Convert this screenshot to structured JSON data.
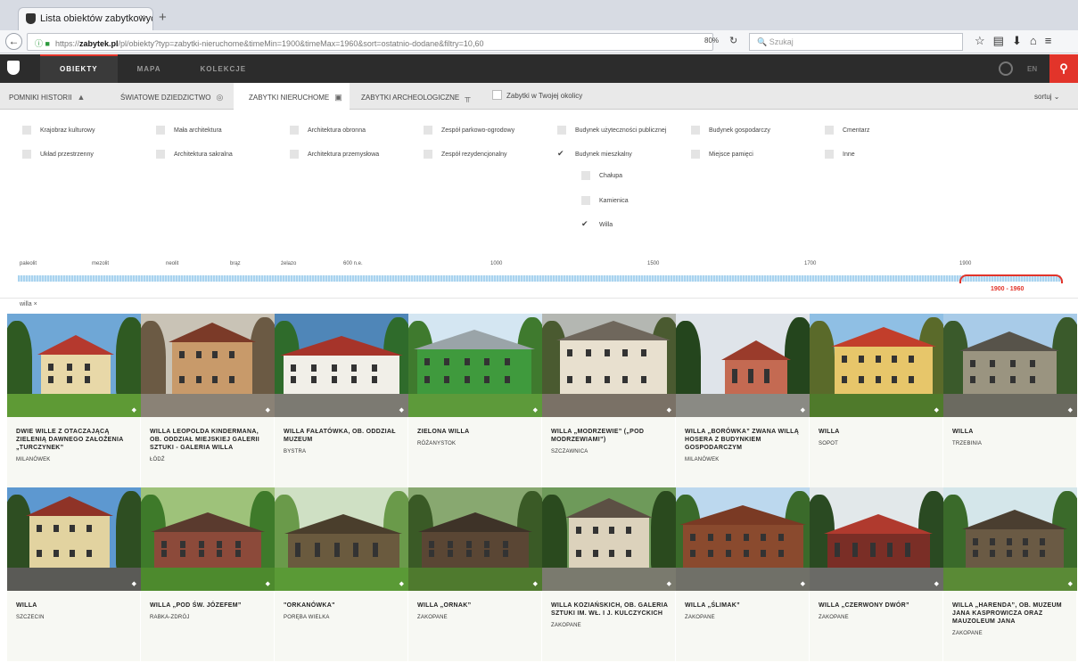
{
  "browser": {
    "tab_title": "Lista obiektów zabytkowyc...",
    "tab_close": "×",
    "new_tab": "+",
    "url_prefix": "https://",
    "url_domain": "zabytek.pl",
    "url_path": "/pl/obiekty?typ=zabytki-nieruchome&timeMin=1900&timeMax=1960&sort=ostatnio-dodane&filtry=10,60",
    "zoom": "80%",
    "search_placeholder": "Szukaj"
  },
  "site_nav": [
    {
      "label": "OBIEKTY",
      "active": true
    },
    {
      "label": "MAPA",
      "active": false
    },
    {
      "label": "KOLEKCJE",
      "active": false
    }
  ],
  "header_lang": "EN",
  "category_tabs": [
    {
      "label": "POMNIKI HISTORII",
      "icon": "monument-icon"
    },
    {
      "label": "ŚWIATOWE DZIEDZICTWO",
      "icon": "unesco-icon"
    },
    {
      "label": "ZABYTKI NIERUCHOME",
      "icon": "building-icon",
      "active": true
    },
    {
      "label": "ZABYTKI ARCHEOLOGICZNE",
      "icon": "dig-icon"
    }
  ],
  "local_filter_label": "Zabytki w Twojej okolicy",
  "sort_label": "sortuj",
  "filters": [
    {
      "label": "Krajobraz kulturowy",
      "checked": false
    },
    {
      "label": "Mała architektura",
      "checked": false
    },
    {
      "label": "Architektura obronna",
      "checked": false
    },
    {
      "label": "Zespół parkowo-ogrodowy",
      "checked": false
    },
    {
      "label": "Budynek użyteczności publicznej",
      "checked": false
    },
    {
      "label": "Budynek gospodarczy",
      "checked": false
    },
    {
      "label": "Cmentarz",
      "checked": false
    },
    {
      "label": "Układ przestrzenny",
      "checked": false
    },
    {
      "label": "Architektura sakralna",
      "checked": false
    },
    {
      "label": "Architektura przemysłowa",
      "checked": false
    },
    {
      "label": "Zespół rezydencjonalny",
      "checked": false
    },
    {
      "label": "Budynek mieszkalny",
      "checked": true
    },
    {
      "label": "Miejsce pamięci",
      "checked": false
    },
    {
      "label": "Inne",
      "checked": false
    }
  ],
  "sub_filters": [
    {
      "label": "Chałupa",
      "checked": false
    },
    {
      "label": "Kamienica",
      "checked": false
    },
    {
      "label": "Willa",
      "checked": true
    }
  ],
  "timeline": {
    "labels": [
      "paleolit",
      "mezolit",
      "neolit",
      "brąz",
      "żelazo",
      "600 n.e.",
      "1000",
      "1500",
      "1700",
      "1900"
    ],
    "range_label": "1900 - 1960"
  },
  "active_chip": "willa",
  "chip_close": "×",
  "cards": [
    {
      "title": "DWIE WILLE Z OTACZAJĄCĄ ZIELENIĄ DAWNEGO ZAŁOŻENIA „TURCZYNEK”",
      "place": "MILANÓWEK"
    },
    {
      "title": "WILLA LEOPOLDA KINDERMANA, OB. ODDZIAŁ MIEJSKIEJ GALERII SZTUKI - GALERIA WILLA",
      "place": "ŁÓDŹ"
    },
    {
      "title": "WILLA FAŁATÓWKA, OB. ODDZIAŁ MUZEUM",
      "place": "BYSTRA"
    },
    {
      "title": "ZIELONA WILLA",
      "place": "RÓŻANYSTOK"
    },
    {
      "title": "WILLA „MODRZEWIE” („POD MODRZEWIAMI”)",
      "place": "SZCZAWNICA"
    },
    {
      "title": "WILLA „BORÓWKA” ZWANA WILLĄ HOSERA Z BUDYNKIEM GOSPODARCZYM",
      "place": "MILANÓWEK"
    },
    {
      "title": "WILLA",
      "place": "SOPOT"
    },
    {
      "title": "WILLA",
      "place": "TRZEBINIA"
    },
    {
      "title": "WILLA",
      "place": "SZCZECIN"
    },
    {
      "title": "WILLA „POD ŚW. JÓZEFEM”",
      "place": "RABKA-ZDRÓJ"
    },
    {
      "title": "\"ORKANÓWKA\"",
      "place": "PORĘBA WIELKA"
    },
    {
      "title": "WILLA „ORNAK”",
      "place": "ZAKOPANE"
    },
    {
      "title": "WILLA KOZIAŃSKICH, OB. GALERIA SZTUKI IM. WŁ. I J. KULCZYCKICH",
      "place": "ZAKOPANE"
    },
    {
      "title": "WILLA „ŚLIMAK”",
      "place": "ZAKOPANE"
    },
    {
      "title": "WILLA „CZERWONY DWÓR”",
      "place": "ZAKOPANE"
    },
    {
      "title": "WILLA „HARENDA”, OB. MUZEUM JANA KASPROWICZA ORAZ MAUZOLEUM JANA",
      "place": "ZAKOPANE"
    }
  ],
  "colors": {
    "accent": "#e2342a",
    "header_bg": "#2c2c2c",
    "card_bg": "#f7f8f3",
    "timeline": "#a9d3ef"
  }
}
